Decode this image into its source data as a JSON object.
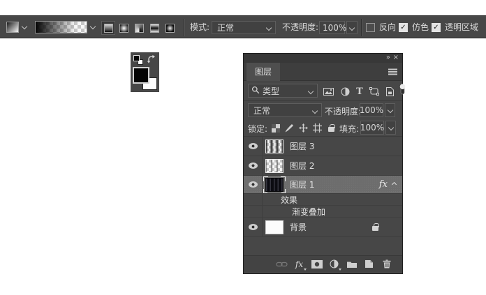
{
  "colors": {
    "toolbar_bg": "#474747",
    "panel_bg": "#474747",
    "selected_row": "#6d6d6d",
    "text": "#d9d9d9",
    "foreground_swatch": "#000000",
    "background_swatch": "#ffffff"
  },
  "options_bar": {
    "mode_label": "模式:",
    "mode_value": "正常",
    "opacity_label": "不透明度:",
    "opacity_value": "100%",
    "check_glyph": "✓",
    "checkboxes": [
      {
        "label": "反向",
        "checked": false
      },
      {
        "label": "仿色",
        "checked": true
      },
      {
        "label": "透明区域",
        "checked": true
      }
    ]
  },
  "layers_panel": {
    "collapse_icon": "»",
    "close_icon": "×",
    "tab_label": "图层",
    "filter_type_label": "类型",
    "filter_text_label": "T",
    "blend_mode_value": "正常",
    "opacity_label": "不透明度:",
    "opacity_value": "100%",
    "lock_label": "锁定:",
    "fill_label": "填充:",
    "fill_value": "100%",
    "fx_label": "fx",
    "effects_label": "效果",
    "gradient_overlay_label": "渐变叠加",
    "layers": [
      {
        "name": "图层 3",
        "visible": true,
        "selected": false
      },
      {
        "name": "图层 2",
        "visible": true,
        "selected": false
      },
      {
        "name": "图层 1",
        "visible": true,
        "selected": true,
        "has_fx": true
      },
      {
        "name": "背景",
        "visible": true,
        "selected": false,
        "locked": true
      }
    ]
  }
}
